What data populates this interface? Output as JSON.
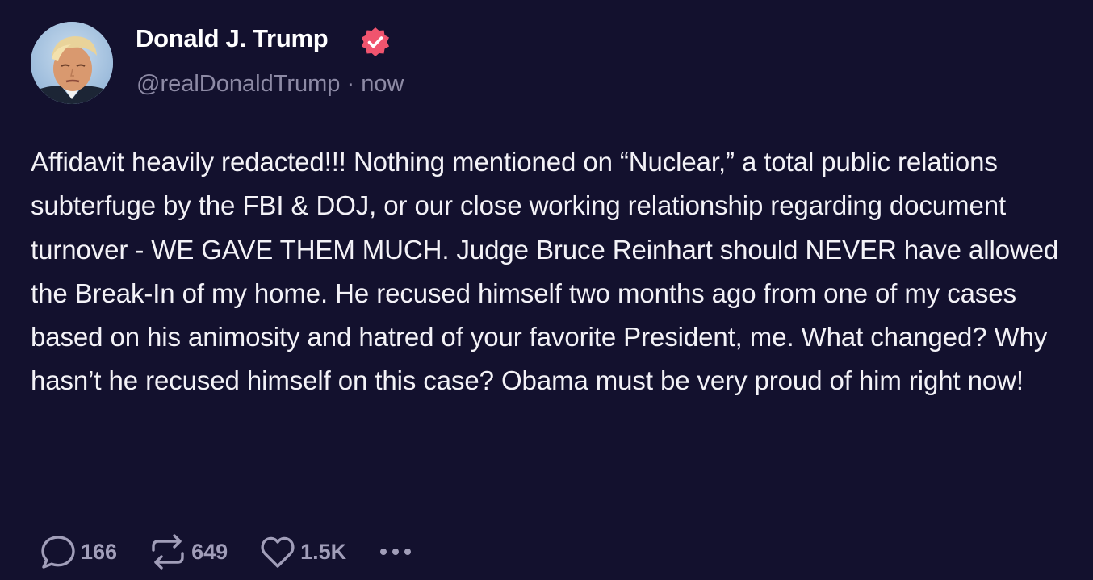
{
  "post": {
    "author": {
      "display_name": "Donald J. Trump",
      "handle": "@realDonaldTrump",
      "separator": " · ",
      "timestamp": "now",
      "verified": true
    },
    "text": "Affidavit heavily redacted!!! Nothing mentioned on “Nuclear,” a total public relations subterfuge by the FBI & DOJ, or our close working relationship regarding document turnover - WE GAVE THEM MUCH. Judge Bruce Reinhart should NEVER have allowed the Break-In of my home. He recused himself two months ago from one of my cases based on his animosity and hatred of your favorite President, me. What changed? Why hasn’t he recused himself on this case? Obama must be very proud of him right now!",
    "actions": {
      "replies": "166",
      "reposts": "649",
      "likes": "1.5K"
    }
  },
  "colors": {
    "background": "#13112e",
    "verified_badge": "#f0546e",
    "muted_text": "#8d8aa5",
    "action_icons": "#a19eb9"
  },
  "icons": [
    "avatar",
    "verified-badge-icon",
    "reply-icon",
    "repost-icon",
    "like-icon",
    "more-icon"
  ]
}
